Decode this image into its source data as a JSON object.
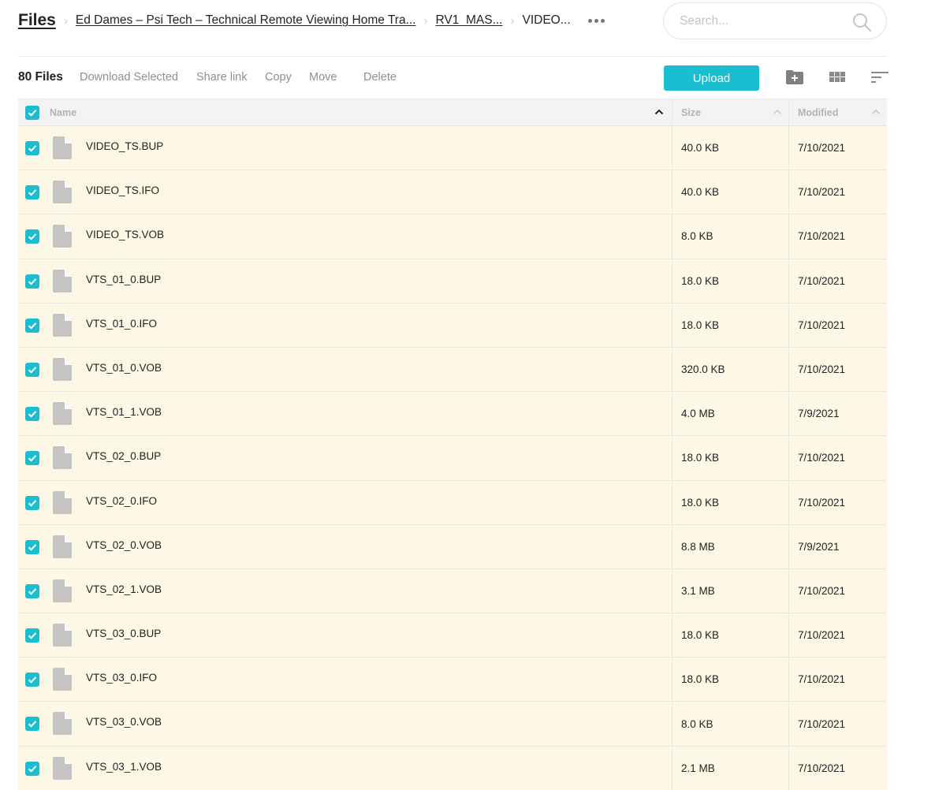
{
  "header": {
    "breadcrumbs": [
      {
        "label": "Files",
        "type": "root"
      },
      {
        "label": "Ed Dames – Psi Tech – Technical Remote Viewing Home Tra...",
        "type": "link"
      },
      {
        "label": "RV1_MAS...",
        "type": "link"
      },
      {
        "label": "VIDEO...",
        "type": "current"
      }
    ],
    "more_icon": "more-horizontal-icon",
    "search": {
      "placeholder": "Search...",
      "value": "",
      "icon": "search-icon"
    }
  },
  "toolbar": {
    "file_count": "80 Files",
    "actions": [
      "Download Selected",
      "Share link",
      "Copy",
      "Move",
      "Delete"
    ],
    "upload_label": "Upload",
    "icons": [
      "new-folder-icon",
      "grid-view-icon",
      "sort-icon"
    ],
    "accent_color": "#1bbed1"
  },
  "table": {
    "select_all_checked": true,
    "columns": [
      {
        "label": "Name",
        "sort": "ascending-active"
      },
      {
        "label": "Size",
        "sort": "ascending"
      },
      {
        "label": "Modified",
        "sort": "ascending"
      }
    ],
    "rows": [
      {
        "name": "VIDEO_TS.BUP",
        "size": "40.0 KB",
        "modified": "7/10/2021",
        "checked": true
      },
      {
        "name": "VIDEO_TS.IFO",
        "size": "40.0 KB",
        "modified": "7/10/2021",
        "checked": true
      },
      {
        "name": "VIDEO_TS.VOB",
        "size": "8.0 KB",
        "modified": "7/10/2021",
        "checked": true
      },
      {
        "name": "VTS_01_0.BUP",
        "size": "18.0 KB",
        "modified": "7/10/2021",
        "checked": true
      },
      {
        "name": "VTS_01_0.IFO",
        "size": "18.0 KB",
        "modified": "7/10/2021",
        "checked": true
      },
      {
        "name": "VTS_01_0.VOB",
        "size": "320.0 KB",
        "modified": "7/10/2021",
        "checked": true
      },
      {
        "name": "VTS_01_1.VOB",
        "size": "4.0 MB",
        "modified": "7/9/2021",
        "checked": true
      },
      {
        "name": "VTS_02_0.BUP",
        "size": "18.0 KB",
        "modified": "7/10/2021",
        "checked": true
      },
      {
        "name": "VTS_02_0.IFO",
        "size": "18.0 KB",
        "modified": "7/10/2021",
        "checked": true
      },
      {
        "name": "VTS_02_0.VOB",
        "size": "8.8 MB",
        "modified": "7/9/2021",
        "checked": true
      },
      {
        "name": "VTS_02_1.VOB",
        "size": "3.1 MB",
        "modified": "7/10/2021",
        "checked": true
      },
      {
        "name": "VTS_03_0.BUP",
        "size": "18.0 KB",
        "modified": "7/10/2021",
        "checked": true
      },
      {
        "name": "VTS_03_0.IFO",
        "size": "18.0 KB",
        "modified": "7/10/2021",
        "checked": true
      },
      {
        "name": "VTS_03_0.VOB",
        "size": "8.0 KB",
        "modified": "7/10/2021",
        "checked": true
      },
      {
        "name": "VTS_03_1.VOB",
        "size": "2.1 MB",
        "modified": "7/10/2021",
        "checked": true
      }
    ]
  }
}
